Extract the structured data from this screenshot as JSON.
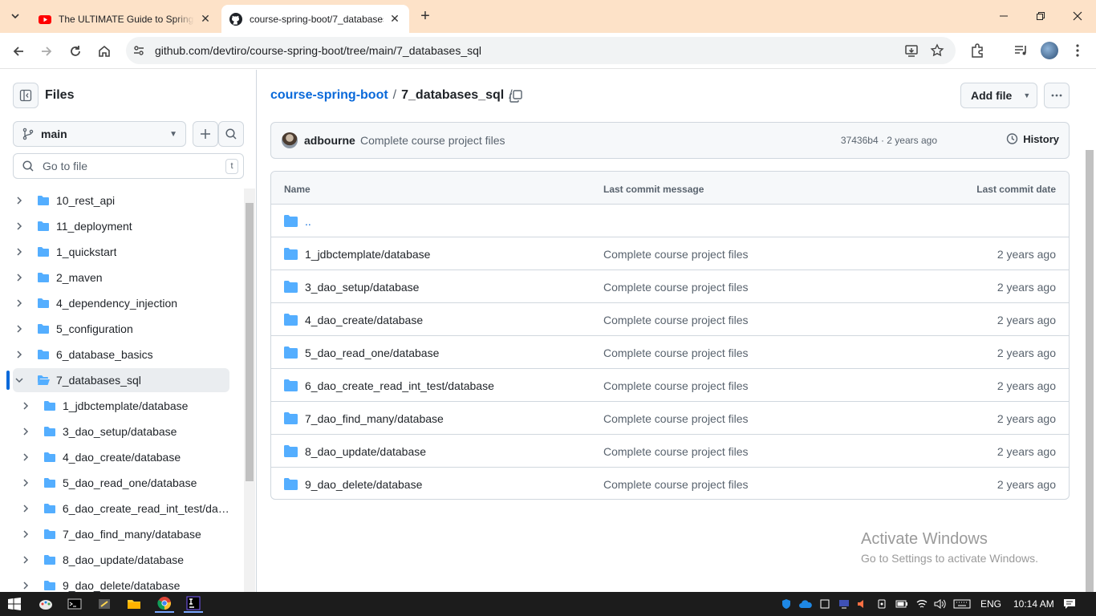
{
  "browser": {
    "tabs": [
      {
        "title": "The ULTIMATE Guide to Spring Boot",
        "active": false
      },
      {
        "title": "course-spring-boot/7_databases_sql",
        "active": true
      }
    ],
    "url": "github.com/devtiro/course-spring-boot/tree/main/7_databases_sql"
  },
  "sidebar": {
    "title": "Files",
    "branch": "main",
    "goto_placeholder": "Go to file",
    "goto_shortcut": "t",
    "items": [
      {
        "label": "10_rest_api",
        "level": 0,
        "expanded": false
      },
      {
        "label": "11_deployment",
        "level": 0,
        "expanded": false
      },
      {
        "label": "1_quickstart",
        "level": 0,
        "expanded": false
      },
      {
        "label": "2_maven",
        "level": 0,
        "expanded": false
      },
      {
        "label": "4_dependency_injection",
        "level": 0,
        "expanded": false
      },
      {
        "label": "5_configuration",
        "level": 0,
        "expanded": false
      },
      {
        "label": "6_database_basics",
        "level": 0,
        "expanded": false
      },
      {
        "label": "7_databases_sql",
        "level": 0,
        "expanded": true,
        "selected": true
      },
      {
        "label": "1_jdbctemplate/database",
        "level": 1,
        "expanded": false
      },
      {
        "label": "3_dao_setup/database",
        "level": 1,
        "expanded": false
      },
      {
        "label": "4_dao_create/database",
        "level": 1,
        "expanded": false
      },
      {
        "label": "5_dao_read_one/database",
        "level": 1,
        "expanded": false
      },
      {
        "label": "6_dao_create_read_int_test/dat...",
        "level": 1,
        "expanded": false
      },
      {
        "label": "7_dao_find_many/database",
        "level": 1,
        "expanded": false
      },
      {
        "label": "8_dao_update/database",
        "level": 1,
        "expanded": false
      },
      {
        "label": "9_dao_delete/database",
        "level": 1,
        "expanded": false
      }
    ]
  },
  "main": {
    "repo": "course-spring-boot",
    "separator": "/",
    "current_dir": "7_databases_sql",
    "add_file_label": "Add file",
    "commit": {
      "author": "adbourne",
      "message": "Complete course project files",
      "sha_time": "37436b4 · 2 years ago",
      "history_label": "History"
    },
    "table": {
      "headers": {
        "name": "Name",
        "message": "Last commit message",
        "date": "Last commit date"
      },
      "parent": "..",
      "rows": [
        {
          "name": "1_jdbctemplate/database",
          "message": "Complete course project files",
          "date": "2 years ago"
        },
        {
          "name": "3_dao_setup/database",
          "message": "Complete course project files",
          "date": "2 years ago"
        },
        {
          "name": "4_dao_create/database",
          "message": "Complete course project files",
          "date": "2 years ago"
        },
        {
          "name": "5_dao_read_one/database",
          "message": "Complete course project files",
          "date": "2 years ago"
        },
        {
          "name": "6_dao_create_read_int_test/database",
          "message": "Complete course project files",
          "date": "2 years ago"
        },
        {
          "name": "7_dao_find_many/database",
          "message": "Complete course project files",
          "date": "2 years ago"
        },
        {
          "name": "8_dao_update/database",
          "message": "Complete course project files",
          "date": "2 years ago"
        },
        {
          "name": "9_dao_delete/database",
          "message": "Complete course project files",
          "date": "2 years ago"
        }
      ]
    }
  },
  "watermark": {
    "line1": "Activate Windows",
    "line2": "Go to Settings to activate Windows."
  },
  "taskbar": {
    "lang": "ENG",
    "time": "10:14 AM"
  },
  "colors": {
    "accent": "#0969da",
    "folder": "#54aeff",
    "tabstrip": "#fde2c8"
  }
}
